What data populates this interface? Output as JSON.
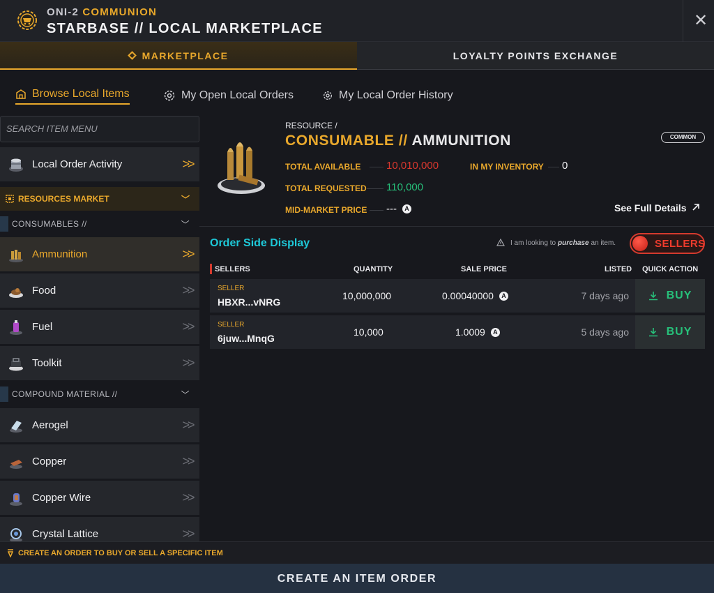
{
  "header": {
    "sub_prefix": "ONI-2",
    "sub_accent": "COMMUNION",
    "title": "STARBASE // LOCAL MARKETPLACE",
    "close_glyph": "✕"
  },
  "top_tabs": [
    {
      "label": "MARKETPLACE",
      "active": true
    },
    {
      "label": "LOYALTY POINTS EXCHANGE",
      "active": false
    }
  ],
  "sub_tabs": [
    {
      "label": "Browse Local Items",
      "icon": "store-icon",
      "active": true
    },
    {
      "label": "My Open Local Orders",
      "icon": "gear-icon",
      "active": false
    },
    {
      "label": "My Local Order History",
      "icon": "gear-icon",
      "active": false
    }
  ],
  "sidebar": {
    "search_placeholder": "SEARCH ITEM MENU",
    "activity_label": "Local Order Activity",
    "section_label": "RESOURCES MARKET",
    "subsections": [
      "CONSUMABLES //",
      "COMPOUND MATERIAL //"
    ],
    "items": [
      {
        "label": "Ammunition",
        "icon": "ammunition-icon",
        "active": true
      },
      {
        "label": "Food",
        "icon": "food-icon",
        "active": false
      },
      {
        "label": "Fuel",
        "icon": "fuel-icon",
        "active": false
      },
      {
        "label": "Toolkit",
        "icon": "toolkit-icon",
        "active": false
      },
      {
        "label": "Aerogel",
        "icon": "aerogel-icon",
        "active": false
      },
      {
        "label": "Copper",
        "icon": "copper-icon",
        "active": false
      },
      {
        "label": "Copper Wire",
        "icon": "copper-wire-icon",
        "active": false
      },
      {
        "label": "Crystal Lattice",
        "icon": "crystal-lattice-icon",
        "active": false
      }
    ]
  },
  "resource": {
    "kind": "RESOURCE /",
    "category": "CONSUMABLE //",
    "name": "AMMUNITION",
    "rarity": "COMMON",
    "total_available_label": "TOTAL AVAILABLE",
    "total_available": "10,010,000",
    "inventory_label": "IN MY INVENTORY",
    "inventory": "0",
    "total_requested_label": "TOTAL REQUESTED",
    "total_requested": "110,000",
    "mid_price_label": "MID-MARKET PRICE",
    "mid_price": "---",
    "see_full": "See Full Details",
    "colors": {
      "available": "#d8372e",
      "requested": "#27c07a",
      "accent": "#e9a82c"
    }
  },
  "orders": {
    "title": "Order Side Display",
    "hint_prefix": "I am looking to",
    "hint_emphasis": "purchase",
    "hint_suffix": "an item.",
    "toggle_label": "SELLERS",
    "columns": [
      "SELLERS",
      "QUANTITY",
      "SALE PRICE",
      "LISTED",
      "QUICK ACTION"
    ],
    "rows": [
      {
        "role": "SELLER",
        "seller": "HBXR...vNRG",
        "quantity": "10,000,000",
        "price": "0.00040000",
        "listed": "7 days ago",
        "action": "BUY"
      },
      {
        "role": "SELLER",
        "seller": "6juw...MnqG",
        "quantity": "10,000",
        "price": "1.0009",
        "listed": "5 days ago",
        "action": "BUY"
      }
    ]
  },
  "footer": {
    "hint": "CREATE AN ORDER TO BUY OR SELL A SPECIFIC ITEM",
    "button": "CREATE AN ITEM ORDER"
  }
}
